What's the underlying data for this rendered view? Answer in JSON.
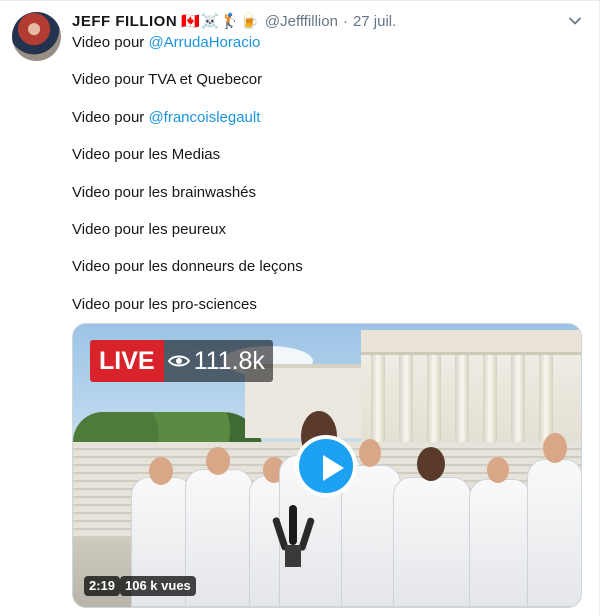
{
  "tweet": {
    "display_name": "JEFF FILLION",
    "emojis": "🇨🇦☠️🏌️🍺",
    "handle": "@Jefffillion",
    "separator": "·",
    "date": "27 juil.",
    "lines": [
      {
        "text": "Video pour ",
        "mention": "@ArrudaHoracio"
      },
      {
        "text": "Video pour TVA et Quebecor",
        "mention": ""
      },
      {
        "text": "Video pour ",
        "mention": "@francoislegault"
      },
      {
        "text": "Video pour les Medias",
        "mention": ""
      },
      {
        "text": "Video pour les brainwashés",
        "mention": ""
      },
      {
        "text": "Video pour les peureux",
        "mention": ""
      },
      {
        "text": "Video pour les donneurs de leçons",
        "mention": ""
      },
      {
        "text": "Video pour les pro-sciences",
        "mention": ""
      }
    ]
  },
  "media": {
    "live_label": "LIVE",
    "viewer_count": "111.8k",
    "duration": "2:19",
    "views": "106 k vues"
  },
  "icons": {
    "more": "chevron-down-icon",
    "eye": "eye-icon",
    "play": "play-icon"
  },
  "colors": {
    "link": "#1b95e0",
    "live_red": "#d8232a",
    "play_blue": "#1da1f2",
    "muted_text": "#657786"
  }
}
